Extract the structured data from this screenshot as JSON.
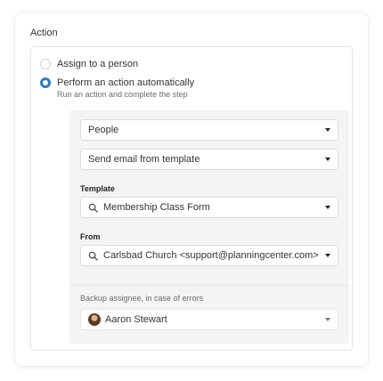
{
  "section": {
    "label": "Action"
  },
  "radios": [
    {
      "label": "Assign to a person",
      "checked": false
    },
    {
      "label": "Perform an action automatically",
      "checked": true,
      "sublabel": "Run an action and complete the step"
    }
  ],
  "selects": {
    "type": {
      "value": "People"
    },
    "action": {
      "value": "Send email from template"
    },
    "template": {
      "label": "Template",
      "value": "Membership Class Form",
      "icon": "search-icon"
    },
    "from": {
      "label": "From",
      "value": "Carlsbad Church <support@planningcenter.com>",
      "icon": "search-icon"
    }
  },
  "backup": {
    "label": "Backup assignee, in case of errors",
    "value": "Aaron Stewart",
    "icon": "avatar"
  },
  "colors": {
    "accent": "#2f79c2",
    "panel_bg": "#f4f4f4",
    "border": "#dcdcdc"
  }
}
